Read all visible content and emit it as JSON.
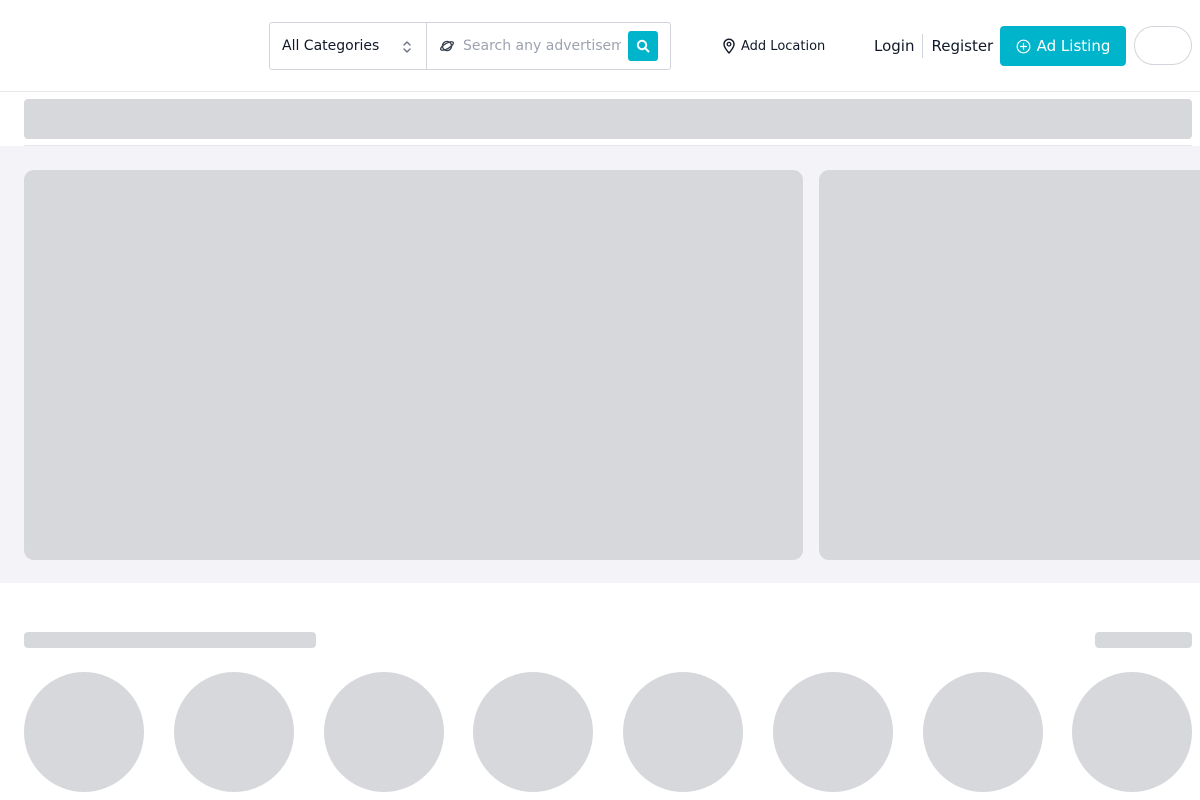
{
  "header": {
    "category_select": {
      "label": "All Categories"
    },
    "search": {
      "placeholder": "Search any advertisement",
      "value": ""
    },
    "location_label": "Add Location",
    "login_label": "Login",
    "register_label": "Register",
    "ad_listing_label": "Ad Listing"
  },
  "icons": {
    "category_chevron": "chevron-up-down-icon",
    "search_prefix": "planet-icon",
    "search_button": "search-icon",
    "location": "map-pin-icon",
    "ad_listing": "plus-circle-icon"
  },
  "colors": {
    "accent": "#00b4cc",
    "skeleton": "#d6d8dc",
    "band_background": "#f4f4f8",
    "border": "#d1d5db"
  }
}
